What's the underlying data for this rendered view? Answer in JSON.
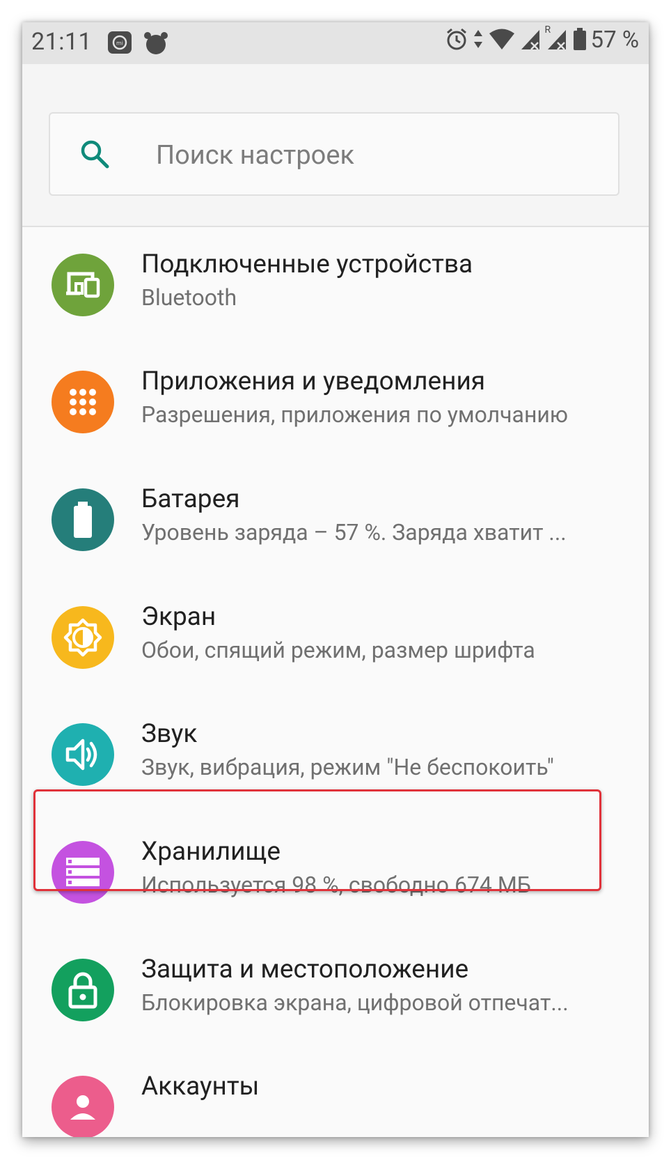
{
  "status_bar": {
    "time": "21:11",
    "battery_text": "57 %",
    "roaming_indicator": "R",
    "icons": [
      "screenshot-icon",
      "alarm-app-icon",
      "alarm-clock-icon",
      "data-arrows-icon",
      "wifi-icon",
      "signal-icon",
      "signal-roaming-icon",
      "battery-icon"
    ]
  },
  "search": {
    "placeholder": "Поиск настроек"
  },
  "settings": [
    {
      "title": "Подключенные устройства",
      "subtitle": "Bluetooth",
      "icon": "devices-icon",
      "color": "#6fa33b"
    },
    {
      "title": "Приложения и уведомления",
      "subtitle": "Разрешения, приложения по умолчанию",
      "icon": "apps-grid-icon",
      "color": "#f57c1f"
    },
    {
      "title": "Батарея",
      "subtitle": "Уровень заряда – 57 %. Заряда хватит ...",
      "icon": "battery-icon",
      "color": "#257e7a"
    },
    {
      "title": "Экран",
      "subtitle": "Обои, спящий режим, размер шрифта",
      "icon": "brightness-icon",
      "color": "#f7b81d"
    },
    {
      "title": "Звук",
      "subtitle": "Звук, вибрация, режим \"Не беспокоить\"",
      "icon": "volume-icon",
      "color": "#1fb0b0"
    },
    {
      "title": "Хранилище",
      "subtitle": "Используется 98 %, свободно 674 МБ",
      "icon": "storage-icon",
      "color": "#c452e0"
    },
    {
      "title": "Защита и местоположение",
      "subtitle": "Блокировка экрана, цифровой отпечат...",
      "icon": "lock-icon",
      "color": "#13a05e"
    },
    {
      "title": "Аккаунты",
      "subtitle": "",
      "icon": "accounts-icon",
      "color": "#ec5d8c"
    }
  ],
  "colors": {
    "highlight_border": "#e0323a",
    "search_icon": "#0f8a7a"
  }
}
